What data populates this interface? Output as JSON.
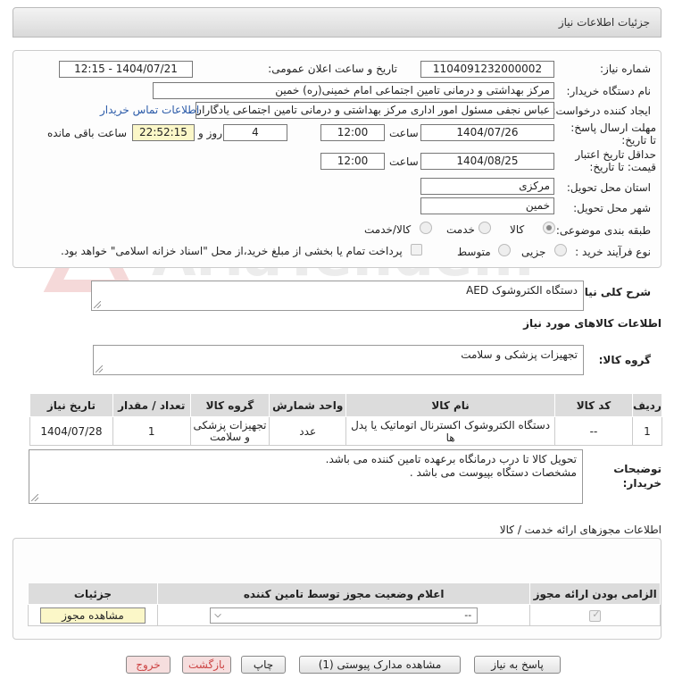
{
  "header": {
    "title": "جزئیات اطلاعات نیاز"
  },
  "form": {
    "need_number_label": "شماره نیاز:",
    "need_number": "1104091232000002",
    "announce_label": "تاریخ و ساعت اعلان عمومی:",
    "announce_value": "1404/07/21 - 12:15",
    "buyer_label": "نام دستگاه خریدار:",
    "buyer_value": "مرکز بهداشتی و درمانی تامین اجتماعی امام خمینی(ره) خمین",
    "creator_label": "ایجاد کننده درخواست:",
    "creator_value": "عباس نجفی مسئول امور اداری مرکز بهداشتی و درمانی تامین اجتماعی یادگاران امام",
    "contact_link": "اطلاعات تماس خریدار",
    "deadline_label": "مهلت ارسال پاسخ: تا تاریخ:",
    "deadline_date": "1404/07/26",
    "time_label": "ساعت",
    "deadline_time": "12:00",
    "days_value": "4",
    "days_label": "روز و",
    "remaining_value": "22:52:15",
    "remaining_label": "ساعت باقی مانده",
    "validity_label": "حداقل تاریخ اعتبار قیمت: تا تاریخ:",
    "validity_date": "1404/08/25",
    "validity_time": "12:00",
    "province_label": "استان محل تحویل:",
    "province_value": "مرکزی",
    "city_label": "شهر محل تحویل:",
    "city_value": "خمین",
    "category_label": "طبقه بندی موضوعی:",
    "category_options": [
      "کالا",
      "خدمت",
      "کالا/خدمت"
    ],
    "category_selected": "کالا",
    "process_label": "نوع فرآیند خرید :",
    "process_options": [
      "جزیی",
      "متوسط"
    ],
    "payment_note": "پرداخت تمام یا بخشی از مبلغ خرید،از محل \"اسناد خزانه اسلامی\" خواهد بود."
  },
  "summary": {
    "label": "شرح کلی نیاز:",
    "value": "دستگاه الکتروشوک AED"
  },
  "goods_info_title": "اطلاعات کالاهای مورد نیاز",
  "goods_group": {
    "label": "گروه کالا:",
    "value": "تجهیزات پزشکی و سلامت"
  },
  "goods_table": {
    "headers": [
      "ردیف",
      "کد کالا",
      "نام کالا",
      "واحد شمارش",
      "گروه کالا",
      "تعداد / مقدار",
      "تاریخ نیاز"
    ],
    "rows": [
      [
        "1",
        "--",
        "دستگاه الکتروشوک اکسترنال اتوماتیک یا پدل ها",
        "عدد",
        "تجهیزات پزشکی و سلامت",
        "1",
        "1404/07/28"
      ]
    ]
  },
  "buyer_notes": {
    "label": "توضیحات خریدار:",
    "line1": "تحویل کالا تا درب درمانگاه برعهده تامین کننده می باشد.",
    "line2": "مشخصات دستگاه بپیوست می باشد ."
  },
  "permits": {
    "title": "اطلاعات مجوزهای ارائه خدمت / کالا",
    "headers": [
      "الزامی بودن ارائه مجوز",
      "اعلام وضعیت مجوز توسط تامین کننده",
      "جزئیات"
    ],
    "select_value": "--",
    "view_button": "مشاهده مجوز"
  },
  "buttons": {
    "reply": "پاسخ به نیاز",
    "attachments": "مشاهده مدارک پیوستی (1)",
    "print": "چاپ",
    "back": "بازگشت",
    "exit": "خروج"
  },
  "watermark": {
    "text": "AriaTender.neT"
  }
}
